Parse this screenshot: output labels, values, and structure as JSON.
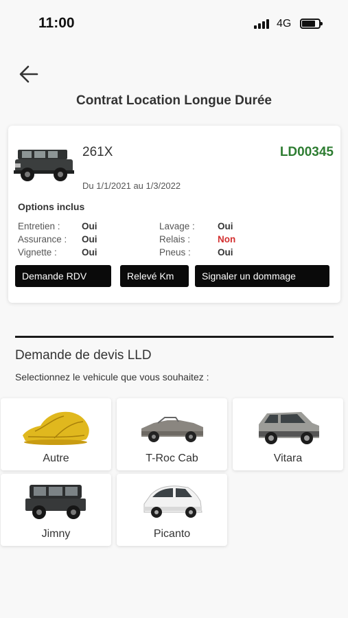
{
  "status": {
    "time": "11:00",
    "network": "4G"
  },
  "header": {
    "title": "Contrat Location Longue Durée"
  },
  "contract": {
    "model": "261X",
    "reference": "LD00345",
    "dates": "Du 1/1/2021 au 1/3/2022",
    "options_title": "Options inclus",
    "options": [
      {
        "label": "Entretien :",
        "value": "Oui"
      },
      {
        "label": "Assurance :",
        "value": "Oui"
      },
      {
        "label": "Vignette :",
        "value": "Oui"
      },
      {
        "label": "Lavage :",
        "value": "Oui"
      },
      {
        "label": "Relais :",
        "value": "Non"
      },
      {
        "label": "Pneus :",
        "value": "Oui"
      }
    ],
    "actions": {
      "rdv": "Demande RDV",
      "km": "Relevé Km",
      "damage": "Signaler un dommage"
    }
  },
  "quote": {
    "title": "Demande de devis LLD",
    "subtitle": "Selectionnez le vehicule que vous souhaitez :",
    "vehicles": [
      {
        "name": "Autre",
        "icon": "covered-car-icon"
      },
      {
        "name": "T-Roc Cab",
        "icon": "convertible-car-icon"
      },
      {
        "name": "Vitara",
        "icon": "suv-car-icon"
      },
      {
        "name": "Jimny",
        "icon": "offroad-car-icon"
      },
      {
        "name": "Picanto",
        "icon": "city-car-icon"
      }
    ]
  },
  "colors": {
    "reference": "#2e7d32",
    "negative": "#d32f2f",
    "button": "#0a0a0a"
  }
}
